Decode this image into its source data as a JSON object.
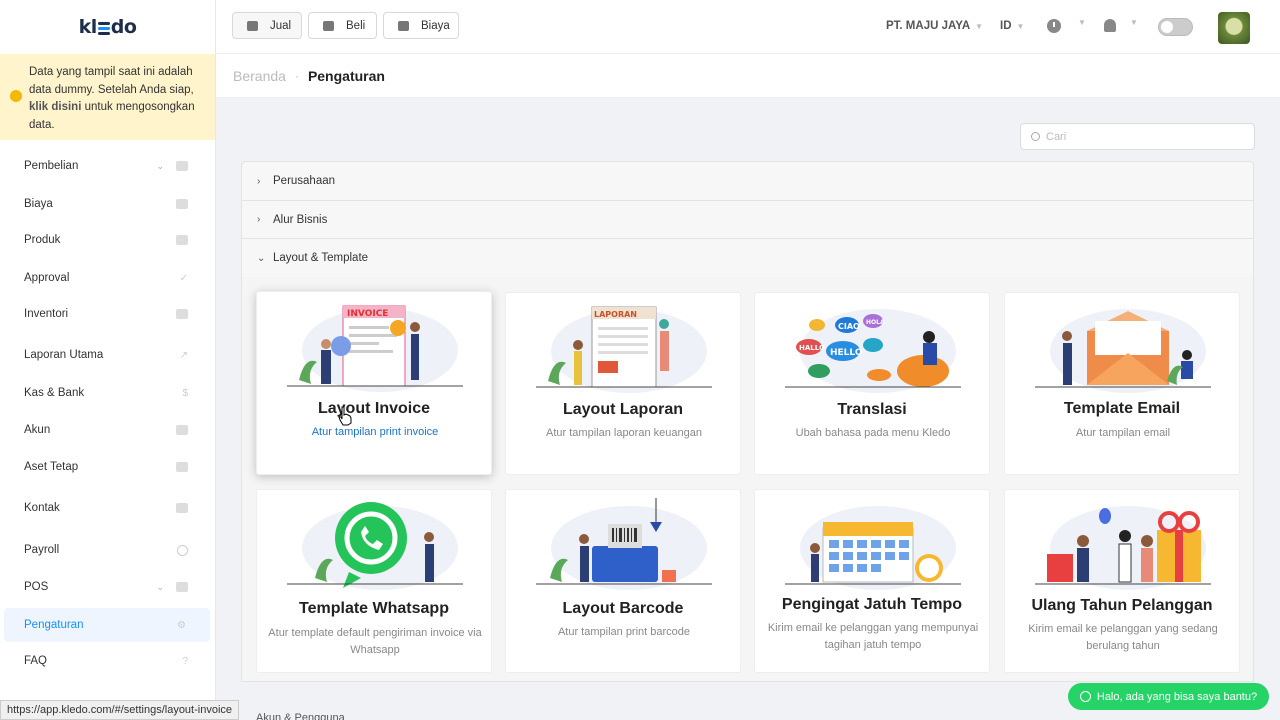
{
  "sidebar": {
    "logo": "kl",
    "logo_end": "do",
    "notice": {
      "text1": "Data yang tampil saat ini adalah data dummy. Setelah Anda siap, ",
      "link": "klik disini",
      "text2": " untuk mengosongkan data."
    },
    "items": [
      {
        "label": "Pembelian",
        "icon": "bag-icon"
      },
      {
        "label": "Biaya",
        "icon": "card-icon"
      },
      {
        "label": "Produk",
        "icon": "box-icon"
      },
      {
        "label": "Approval",
        "icon": "check-icon"
      },
      {
        "label": "Inventori",
        "icon": "inventory-icon"
      },
      {
        "label": "Laporan Utama",
        "icon": "chart-icon"
      },
      {
        "label": "Kas & Bank",
        "icon": "dollar-icon"
      },
      {
        "label": "Akun",
        "icon": "account-icon"
      },
      {
        "label": "Aset Tetap",
        "icon": "building-icon"
      },
      {
        "label": "Kontak",
        "icon": "contact-icon"
      },
      {
        "label": "Payroll",
        "icon": "payroll-icon"
      },
      {
        "label": "POS",
        "icon": "pos-icon"
      },
      {
        "label": "Pengaturan",
        "icon": "gear-icon"
      },
      {
        "label": "FAQ",
        "icon": "question-icon"
      }
    ]
  },
  "topbar": {
    "jual": "Jual",
    "beli": "Beli",
    "biaya": "Biaya",
    "company": "PT. MAJU JAYA",
    "lang": "ID"
  },
  "breadcrumb": {
    "home": "Beranda",
    "current": "Pengaturan"
  },
  "search": {
    "placeholder": "Cari"
  },
  "sections": {
    "s1": "Perusahaan",
    "s2": "Alur Bisnis",
    "s3": "Layout & Template",
    "s4": "Akun & Pengguna"
  },
  "cards": [
    {
      "title": "Layout Invoice",
      "desc": "Atur tampilan print invoice"
    },
    {
      "title": "Layout Laporan",
      "desc": "Atur tampilan laporan keuangan"
    },
    {
      "title": "Translasi",
      "desc": "Ubah bahasa pada menu Kledo"
    },
    {
      "title": "Template Email",
      "desc": "Atur tampilan email"
    },
    {
      "title": "Template Whatsapp",
      "desc": "Atur template default pengiriman invoice via Whatsapp"
    },
    {
      "title": "Layout Barcode",
      "desc": "Atur tampilan print barcode"
    },
    {
      "title": "Pengingat Jatuh Tempo",
      "desc": "Kirim email ke pelanggan yang mempunyai tagihan jatuh tempo"
    },
    {
      "title": "Ulang Tahun Pelanggan",
      "desc": "Kirim email ke pelanggan yang sedang berulang tahun"
    }
  ],
  "illus": {
    "invoice": "INVOICE",
    "laporan": "LAPORAN",
    "hello": "HELLO",
    "ciao": "CIAO",
    "hallo": "HALLO",
    "hola": "HOLA"
  },
  "statusbar": "https://app.kledo.com/#/settings/layout-invoice",
  "chat": "Halo, ada yang bisa saya bantu?"
}
